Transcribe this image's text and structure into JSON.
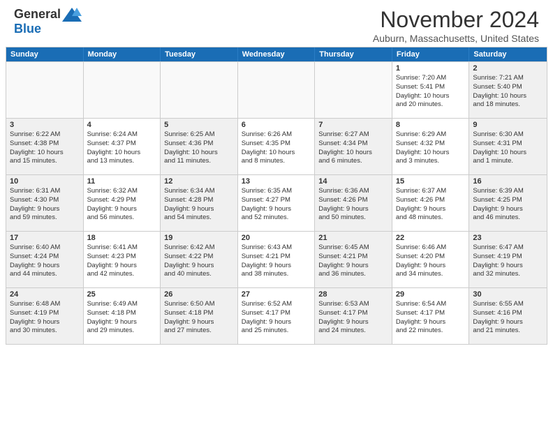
{
  "header": {
    "logo_general": "General",
    "logo_blue": "Blue",
    "title": "November 2024",
    "location": "Auburn, Massachusetts, United States"
  },
  "day_headers": [
    "Sunday",
    "Monday",
    "Tuesday",
    "Wednesday",
    "Thursday",
    "Friday",
    "Saturday"
  ],
  "weeks": [
    [
      {
        "day": "",
        "lines": [],
        "empty": true
      },
      {
        "day": "",
        "lines": [],
        "empty": true
      },
      {
        "day": "",
        "lines": [],
        "empty": true
      },
      {
        "day": "",
        "lines": [],
        "empty": true
      },
      {
        "day": "",
        "lines": [],
        "empty": true
      },
      {
        "day": "1",
        "lines": [
          "Sunrise: 7:20 AM",
          "Sunset: 5:41 PM",
          "Daylight: 10 hours",
          "and 20 minutes."
        ],
        "empty": false
      },
      {
        "day": "2",
        "lines": [
          "Sunrise: 7:21 AM",
          "Sunset: 5:40 PM",
          "Daylight: 10 hours",
          "and 18 minutes."
        ],
        "empty": false
      }
    ],
    [
      {
        "day": "3",
        "lines": [
          "Sunrise: 6:22 AM",
          "Sunset: 4:38 PM",
          "Daylight: 10 hours",
          "and 15 minutes."
        ],
        "empty": false
      },
      {
        "day": "4",
        "lines": [
          "Sunrise: 6:24 AM",
          "Sunset: 4:37 PM",
          "Daylight: 10 hours",
          "and 13 minutes."
        ],
        "empty": false
      },
      {
        "day": "5",
        "lines": [
          "Sunrise: 6:25 AM",
          "Sunset: 4:36 PM",
          "Daylight: 10 hours",
          "and 11 minutes."
        ],
        "empty": false
      },
      {
        "day": "6",
        "lines": [
          "Sunrise: 6:26 AM",
          "Sunset: 4:35 PM",
          "Daylight: 10 hours",
          "and 8 minutes."
        ],
        "empty": false
      },
      {
        "day": "7",
        "lines": [
          "Sunrise: 6:27 AM",
          "Sunset: 4:34 PM",
          "Daylight: 10 hours",
          "and 6 minutes."
        ],
        "empty": false
      },
      {
        "day": "8",
        "lines": [
          "Sunrise: 6:29 AM",
          "Sunset: 4:32 PM",
          "Daylight: 10 hours",
          "and 3 minutes."
        ],
        "empty": false
      },
      {
        "day": "9",
        "lines": [
          "Sunrise: 6:30 AM",
          "Sunset: 4:31 PM",
          "Daylight: 10 hours",
          "and 1 minute."
        ],
        "empty": false
      }
    ],
    [
      {
        "day": "10",
        "lines": [
          "Sunrise: 6:31 AM",
          "Sunset: 4:30 PM",
          "Daylight: 9 hours",
          "and 59 minutes."
        ],
        "empty": false
      },
      {
        "day": "11",
        "lines": [
          "Sunrise: 6:32 AM",
          "Sunset: 4:29 PM",
          "Daylight: 9 hours",
          "and 56 minutes."
        ],
        "empty": false
      },
      {
        "day": "12",
        "lines": [
          "Sunrise: 6:34 AM",
          "Sunset: 4:28 PM",
          "Daylight: 9 hours",
          "and 54 minutes."
        ],
        "empty": false
      },
      {
        "day": "13",
        "lines": [
          "Sunrise: 6:35 AM",
          "Sunset: 4:27 PM",
          "Daylight: 9 hours",
          "and 52 minutes."
        ],
        "empty": false
      },
      {
        "day": "14",
        "lines": [
          "Sunrise: 6:36 AM",
          "Sunset: 4:26 PM",
          "Daylight: 9 hours",
          "and 50 minutes."
        ],
        "empty": false
      },
      {
        "day": "15",
        "lines": [
          "Sunrise: 6:37 AM",
          "Sunset: 4:26 PM",
          "Daylight: 9 hours",
          "and 48 minutes."
        ],
        "empty": false
      },
      {
        "day": "16",
        "lines": [
          "Sunrise: 6:39 AM",
          "Sunset: 4:25 PM",
          "Daylight: 9 hours",
          "and 46 minutes."
        ],
        "empty": false
      }
    ],
    [
      {
        "day": "17",
        "lines": [
          "Sunrise: 6:40 AM",
          "Sunset: 4:24 PM",
          "Daylight: 9 hours",
          "and 44 minutes."
        ],
        "empty": false
      },
      {
        "day": "18",
        "lines": [
          "Sunrise: 6:41 AM",
          "Sunset: 4:23 PM",
          "Daylight: 9 hours",
          "and 42 minutes."
        ],
        "empty": false
      },
      {
        "day": "19",
        "lines": [
          "Sunrise: 6:42 AM",
          "Sunset: 4:22 PM",
          "Daylight: 9 hours",
          "and 40 minutes."
        ],
        "empty": false
      },
      {
        "day": "20",
        "lines": [
          "Sunrise: 6:43 AM",
          "Sunset: 4:21 PM",
          "Daylight: 9 hours",
          "and 38 minutes."
        ],
        "empty": false
      },
      {
        "day": "21",
        "lines": [
          "Sunrise: 6:45 AM",
          "Sunset: 4:21 PM",
          "Daylight: 9 hours",
          "and 36 minutes."
        ],
        "empty": false
      },
      {
        "day": "22",
        "lines": [
          "Sunrise: 6:46 AM",
          "Sunset: 4:20 PM",
          "Daylight: 9 hours",
          "and 34 minutes."
        ],
        "empty": false
      },
      {
        "day": "23",
        "lines": [
          "Sunrise: 6:47 AM",
          "Sunset: 4:19 PM",
          "Daylight: 9 hours",
          "and 32 minutes."
        ],
        "empty": false
      }
    ],
    [
      {
        "day": "24",
        "lines": [
          "Sunrise: 6:48 AM",
          "Sunset: 4:19 PM",
          "Daylight: 9 hours",
          "and 30 minutes."
        ],
        "empty": false
      },
      {
        "day": "25",
        "lines": [
          "Sunrise: 6:49 AM",
          "Sunset: 4:18 PM",
          "Daylight: 9 hours",
          "and 29 minutes."
        ],
        "empty": false
      },
      {
        "day": "26",
        "lines": [
          "Sunrise: 6:50 AM",
          "Sunset: 4:18 PM",
          "Daylight: 9 hours",
          "and 27 minutes."
        ],
        "empty": false
      },
      {
        "day": "27",
        "lines": [
          "Sunrise: 6:52 AM",
          "Sunset: 4:17 PM",
          "Daylight: 9 hours",
          "and 25 minutes."
        ],
        "empty": false
      },
      {
        "day": "28",
        "lines": [
          "Sunrise: 6:53 AM",
          "Sunset: 4:17 PM",
          "Daylight: 9 hours",
          "and 24 minutes."
        ],
        "empty": false
      },
      {
        "day": "29",
        "lines": [
          "Sunrise: 6:54 AM",
          "Sunset: 4:17 PM",
          "Daylight: 9 hours",
          "and 22 minutes."
        ],
        "empty": false
      },
      {
        "day": "30",
        "lines": [
          "Sunrise: 6:55 AM",
          "Sunset: 4:16 PM",
          "Daylight: 9 hours",
          "and 21 minutes."
        ],
        "empty": false
      }
    ]
  ]
}
